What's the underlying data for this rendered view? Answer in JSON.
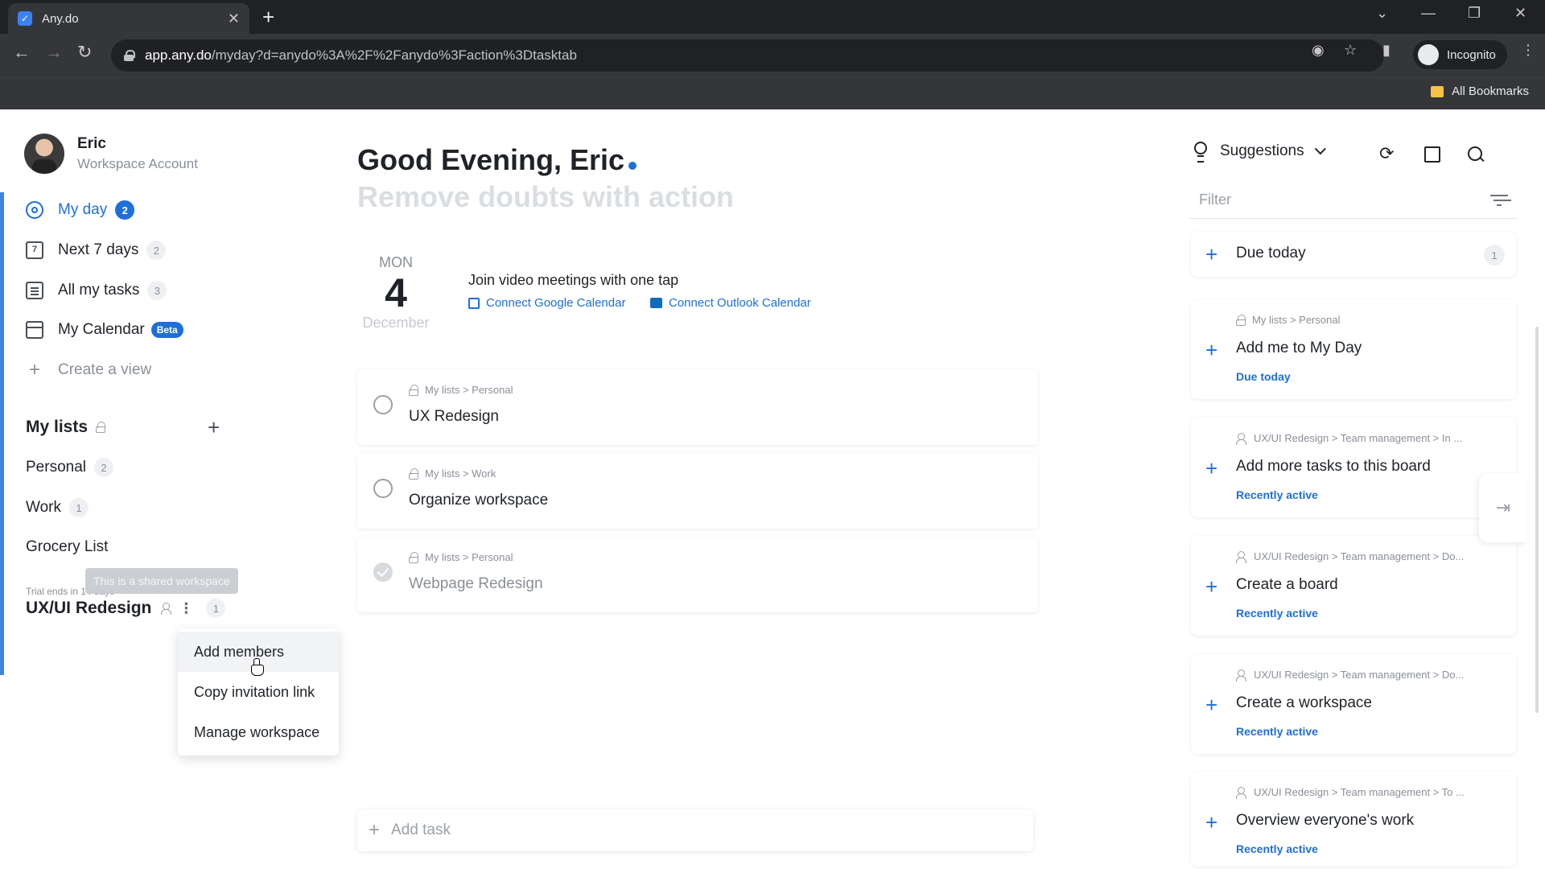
{
  "browser": {
    "tab_title": "Any.do",
    "url_host": "app.any.do",
    "url_path": "/myday?d=anydo%3A%2F%2Fanydo%3Faction%3Dtasktab",
    "incognito_label": "Incognito",
    "bookmarks_label": "All Bookmarks"
  },
  "profile": {
    "name": "Eric",
    "account": "Workspace Account"
  },
  "nav": {
    "my_day": {
      "label": "My day",
      "count": "2"
    },
    "next7": {
      "label": "Next 7 days",
      "count": "2",
      "icon_num": "7"
    },
    "all_tasks": {
      "label": "All my tasks",
      "count": "3"
    },
    "calendar": {
      "label": "My Calendar",
      "badge": "Beta"
    },
    "create_view": "Create a view"
  },
  "lists": {
    "title": "My lists",
    "items": [
      {
        "label": "Personal",
        "count": "2"
      },
      {
        "label": "Work",
        "count": "1"
      },
      {
        "label": "Grocery List",
        "count": ""
      }
    ]
  },
  "workspace": {
    "trial": "Trial ends in 14 days",
    "tooltip": "This is a shared workspace",
    "name": "UX/UI Redesign",
    "count": "1",
    "menu": [
      "Add members",
      "Copy invitation link",
      "Manage workspace"
    ]
  },
  "main": {
    "greeting": "Good Evening, Eric",
    "tagline": "Remove doubts with action",
    "date": {
      "dow": "MON",
      "day": "4",
      "month": "December"
    },
    "video_title": "Join video meetings with one tap",
    "connect_google": "Connect Google Calendar",
    "connect_outlook": "Connect Outlook Calendar",
    "tasks": [
      {
        "crumb": "My lists > Personal",
        "name": "UX Redesign",
        "done": false
      },
      {
        "crumb": "My lists > Work",
        "name": "Organize workspace",
        "done": false
      },
      {
        "crumb": "My lists > Personal",
        "name": "Webpage Redesign",
        "done": true
      }
    ],
    "add_task_placeholder": "Add task"
  },
  "right": {
    "suggestions_label": "Suggestions",
    "filter_placeholder": "Filter",
    "due_today": {
      "label": "Due today",
      "count": "1"
    },
    "cards": [
      {
        "crumb": "My lists > Personal",
        "title": "Add me to My Day",
        "sub": "Due today",
        "shared": false
      },
      {
        "crumb": "UX/UI Redesign > Team management > In ...",
        "title": "Add more tasks to this board",
        "sub": "Recently active",
        "shared": true
      },
      {
        "crumb": "UX/UI Redesign > Team management > Do...",
        "title": "Create a board",
        "sub": "Recently active",
        "shared": true
      },
      {
        "crumb": "UX/UI Redesign > Team management > Do...",
        "title": "Create a workspace",
        "sub": "Recently active",
        "shared": true
      },
      {
        "crumb": "UX/UI Redesign > Team management > To ...",
        "title": "Overview everyone's work",
        "sub": "Recently active",
        "shared": true
      }
    ]
  },
  "colors": {
    "accent": "#1e6fd9",
    "muted": "#8a8f98"
  }
}
